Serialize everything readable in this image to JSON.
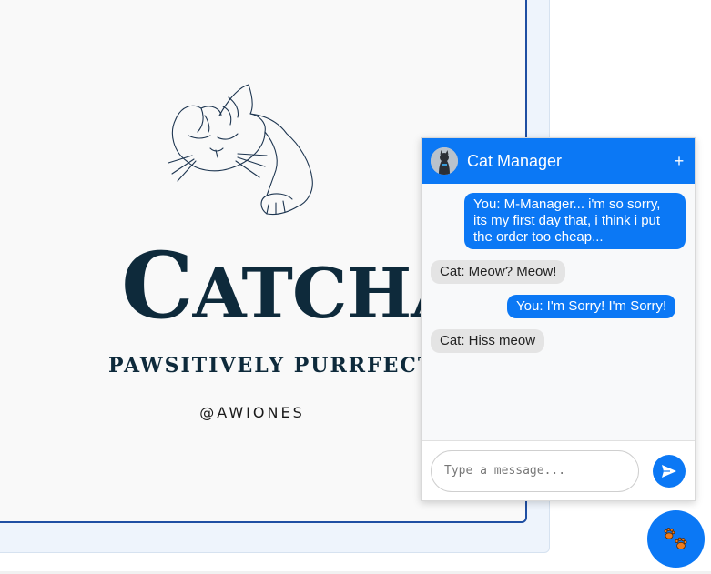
{
  "poster": {
    "title": "CATCHAT",
    "title_first": "C",
    "title_rest": "ATCHAT",
    "tagline": "PAWSITIVELY PURRFECT",
    "handle": "@AWIONES"
  },
  "chat": {
    "title": "Cat Manager",
    "expand_label": "+",
    "messages": [
      {
        "sender": "user",
        "text": "You: M-Manager... i'm so sorry, its my first day that, i think i put the order too cheap..."
      },
      {
        "sender": "cat",
        "text": "Cat: Meow? Meow!"
      },
      {
        "sender": "user",
        "text": "You: I'm Sorry! I'm Sorry!"
      },
      {
        "sender": "cat",
        "text": "Cat: Hiss meow"
      }
    ],
    "input": {
      "placeholder": "Type a message...",
      "value": ""
    },
    "send_icon": "send-arrow-icon"
  },
  "fab": {
    "icon": "paw-prints-icon"
  },
  "colors": {
    "accent": "#0b78f5",
    "logo": "#0e2a3b",
    "poster_border": "#1f4fa3",
    "paw": "#f07c1c"
  }
}
